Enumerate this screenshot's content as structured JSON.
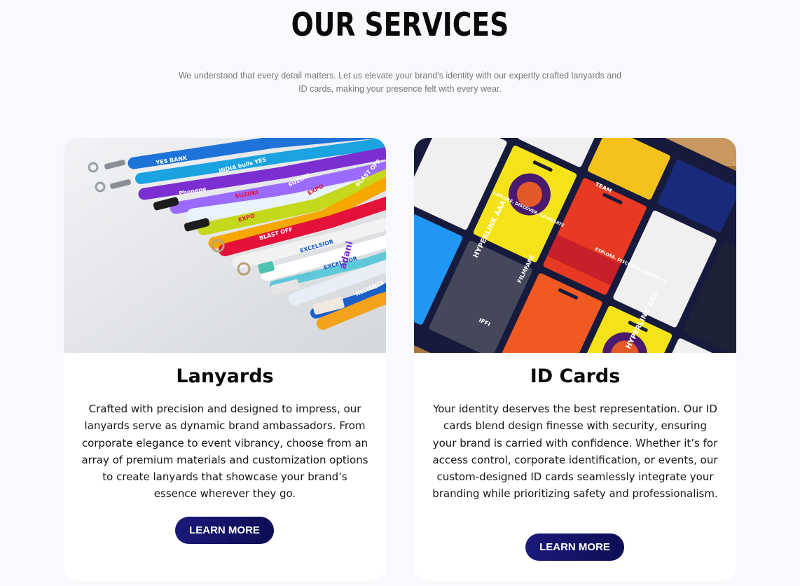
{
  "section": {
    "title": "OUR SERVICES",
    "subtitle": "We understand that every detail matters. Let us elevate your brand's identity with our expertly crafted lanyards and ID cards, making your presence felt with every wear."
  },
  "cards": [
    {
      "title": "Lanyards",
      "description": "Crafted with precision and designed to impress, our lanyards serve as dynamic brand ambassadors. From corporate elegance to event vibrancy, choose from an array of premium materials and customization options to create lanyards that showcase your brand’s essence wherever they go.",
      "button_label": "LEARN MORE",
      "image": "lanyards-photo",
      "image_text": [
        "YES BANK",
        "INDIA bulls YES",
        "Phonepe",
        "SUZUKI",
        "SUZUKI",
        "EXPO",
        "EXPO",
        "BLAST OFF",
        "BLAST OFF",
        "EXCELSIOR",
        "EXCELSIOR",
        "adani",
        "RELIANCE"
      ]
    },
    {
      "title": "ID Cards",
      "description": "Your identity deserves the best representation. Our ID cards blend design finesse with security, ensuring your brand is carried with confidence. Whether it’s for access control, corporate identification, or events, our custom-designed ID cards seamlessly integrate your branding while prioritizing safety and professionalism.",
      "button_label": "LEARN MORE",
      "image": "id-cards-photo",
      "image_text": [
        "TEAM",
        "HYPERLINK AAA",
        "HYPERLINK AAA",
        "EXPLORE. DISCOVER. CELEBRATE",
        "EXPLORE. DISCOVER. CELEBRATE",
        "FILMFARE",
        "IFFI"
      ]
    }
  ]
}
